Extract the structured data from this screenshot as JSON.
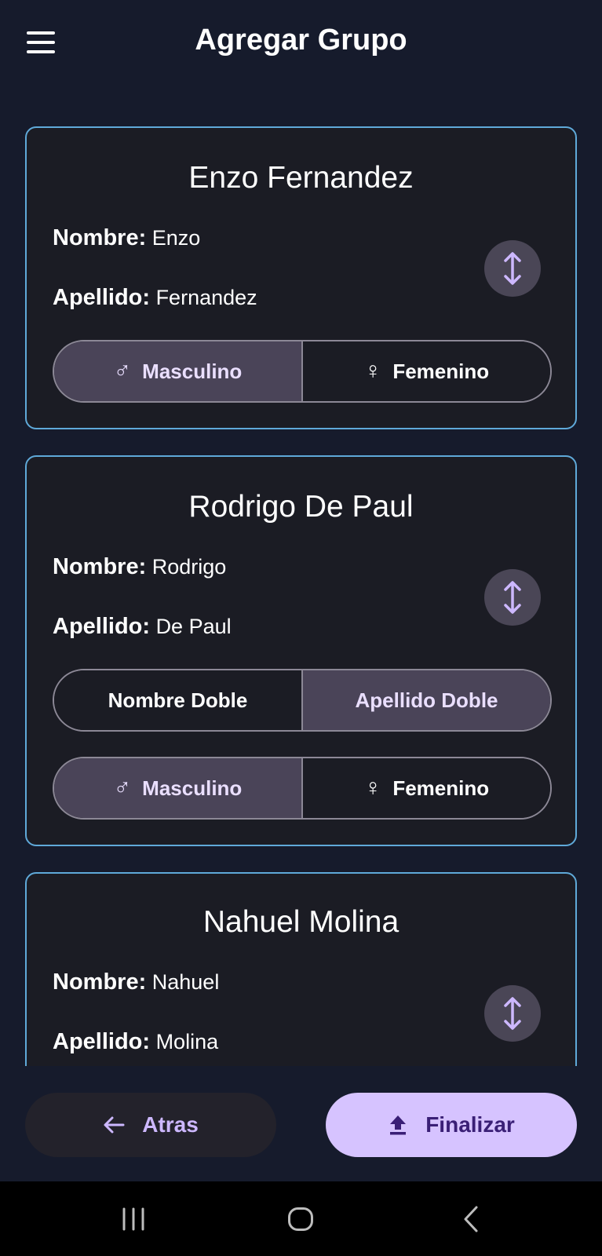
{
  "header": {
    "title": "Agregar Grupo"
  },
  "people": [
    {
      "full_name": "Enzo Fernandez",
      "nombre_label": "Nombre:",
      "nombre": "Enzo",
      "apellido_label": "Apellido:",
      "apellido": "Fernandez",
      "gender_options": [
        {
          "label": "Masculino",
          "icon": "male-icon",
          "selected": true
        },
        {
          "label": "Femenino",
          "icon": "female-icon",
          "selected": false
        }
      ]
    },
    {
      "full_name": "Rodrigo De Paul",
      "nombre_label": "Nombre:",
      "nombre": "Rodrigo",
      "apellido_label": "Apellido:",
      "apellido": "De Paul",
      "double_options": [
        {
          "label": "Nombre Doble",
          "selected": false
        },
        {
          "label": "Apellido Doble",
          "selected": true
        }
      ],
      "gender_options": [
        {
          "label": "Masculino",
          "icon": "male-icon",
          "selected": true
        },
        {
          "label": "Femenino",
          "icon": "female-icon",
          "selected": false
        }
      ]
    },
    {
      "full_name": "Nahuel Molina",
      "nombre_label": "Nombre:",
      "nombre": "Nahuel",
      "apellido_label": "Apellido:",
      "apellido": "Molina"
    }
  ],
  "actions": {
    "back_label": "Atras",
    "back_icon": "arrow-left-icon",
    "finish_label": "Finalizar",
    "finish_icon": "upload-icon"
  },
  "colors": {
    "background": "#161b2c",
    "card": "#1b1c24",
    "card_border": "#5fa9d9",
    "segment_selected": "#4a4458",
    "accent": "#d6c3ff"
  }
}
